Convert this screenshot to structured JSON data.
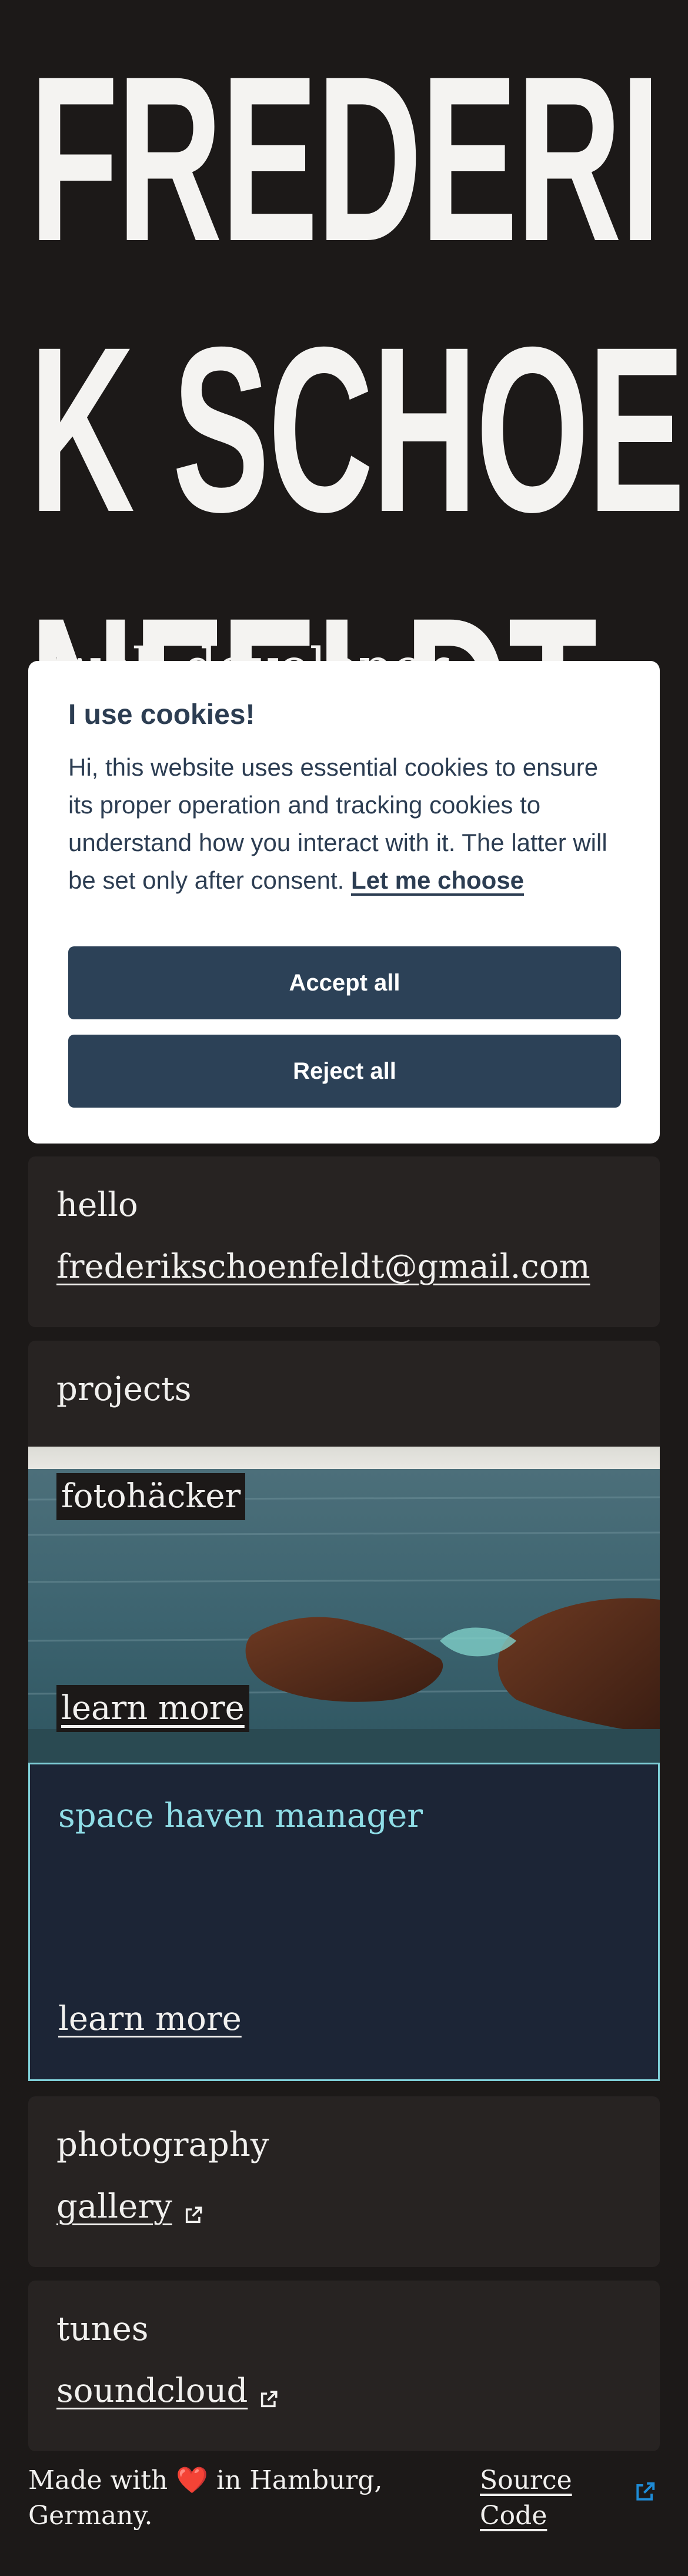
{
  "hero": {
    "title_lines": [
      "FREDERI",
      "K SCHOE",
      "NFELDT"
    ],
    "peek": "web developer"
  },
  "cookie": {
    "title": "I use cookies!",
    "text": "Hi, this website uses essential cookies to ensure its proper operation and tracking cookies to understand how you interact with it. The latter will be set only after consent.",
    "link": "Let me choose",
    "accept": "Accept all",
    "reject": "Reject all"
  },
  "hello": {
    "title": "hello",
    "email": "frederikschoenfeldt@gmail.com"
  },
  "projects": {
    "title": "projects",
    "items": [
      {
        "name": "fotohäcker",
        "cta": "learn more"
      },
      {
        "name": "space haven manager",
        "cta": "learn more"
      }
    ]
  },
  "photography": {
    "title": "photography",
    "link": "gallery"
  },
  "tunes": {
    "title": "tunes",
    "link": "soundcloud"
  },
  "footer": {
    "made_with": "Made with",
    "heart": "❤️",
    "location": "in Hamburg, Germany.",
    "source": "Source Code"
  },
  "colors": {
    "background": "#1c1918",
    "card": "#272322",
    "button": "#2c4157",
    "accent": "#7fcfd8"
  }
}
